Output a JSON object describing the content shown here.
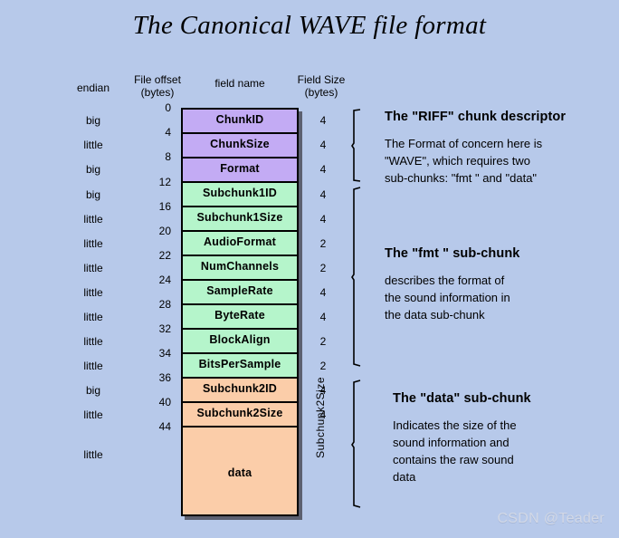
{
  "title": "The Canonical WAVE file format",
  "colors": {
    "background": "#b7c9ea",
    "riff_chunk": "#c3abf4",
    "fmt_chunk": "#b5f5cb",
    "data_chunk": "#fbcda9",
    "border": "#000000",
    "shadow": "#5c6070",
    "watermark": "#d2d8e6"
  },
  "headers": {
    "endian": "endian",
    "file_offset_line1": "File offset",
    "file_offset_line2": "(bytes)",
    "field_name": "field name",
    "field_size_line1": "Field Size",
    "field_size_line2": "(bytes)"
  },
  "rows": [
    {
      "endian": "big",
      "offset": "0",
      "field": "ChunkID",
      "size": "4",
      "group": "riff"
    },
    {
      "endian": "little",
      "offset": "4",
      "field": "ChunkSize",
      "size": "4",
      "group": "riff"
    },
    {
      "endian": "big",
      "offset": "8",
      "field": "Format",
      "size": "4",
      "group": "riff"
    },
    {
      "endian": "big",
      "offset": "12",
      "field": "Subchunk1ID",
      "size": "4",
      "group": "fmt"
    },
    {
      "endian": "little",
      "offset": "16",
      "field": "Subchunk1Size",
      "size": "4",
      "group": "fmt"
    },
    {
      "endian": "little",
      "offset": "20",
      "field": "AudioFormat",
      "size": "2",
      "group": "fmt"
    },
    {
      "endian": "little",
      "offset": "22",
      "field": "NumChannels",
      "size": "2",
      "group": "fmt"
    },
    {
      "endian": "little",
      "offset": "24",
      "field": "SampleRate",
      "size": "4",
      "group": "fmt"
    },
    {
      "endian": "little",
      "offset": "28",
      "field": "ByteRate",
      "size": "4",
      "group": "fmt"
    },
    {
      "endian": "little",
      "offset": "32",
      "field": "BlockAlign",
      "size": "2",
      "group": "fmt"
    },
    {
      "endian": "little",
      "offset": "34",
      "field": "BitsPerSample",
      "size": "2",
      "group": "fmt"
    },
    {
      "endian": "big",
      "offset": "36",
      "field": "Subchunk2ID",
      "size": "4",
      "group": "data"
    },
    {
      "endian": "little",
      "offset": "40",
      "field": "Subchunk2Size",
      "size": "4",
      "group": "data"
    },
    {
      "endian": "little",
      "offset": "44",
      "field": "data",
      "size": "Subchunk2Size",
      "group": "data"
    }
  ],
  "data_size_label": "Subchunk2Size",
  "annotations": {
    "riff": {
      "heading": "The \"RIFF\" chunk descriptor",
      "body_line1": "The Format of concern here is",
      "body_line2": "\"WAVE\", which requires two",
      "body_line3": "sub-chunks: \"fmt \" and \"data\""
    },
    "fmt": {
      "heading": "The \"fmt \" sub-chunk",
      "body_line1": "describes the format of",
      "body_line2": "the sound information in",
      "body_line3": "the data sub-chunk"
    },
    "data": {
      "heading": "The \"data\" sub-chunk",
      "body_line1": "Indicates the size of the",
      "body_line2": "sound information and",
      "body_line3": "contains the raw sound",
      "body_line4": "data"
    }
  },
  "watermark": "CSDN @Teader"
}
